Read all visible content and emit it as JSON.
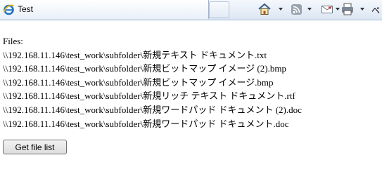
{
  "tab": {
    "title": "Test"
  },
  "toolbar": {
    "trailing_text": "ペ"
  },
  "page": {
    "files_label": "Files:",
    "files": [
      "\\\\192.168.11.146\\test_work\\subfolder\\新規テキスト ドキュメント.txt",
      "\\\\192.168.11.146\\test_work\\subfolder\\新規ビットマップ イメージ (2).bmp",
      "\\\\192.168.11.146\\test_work\\subfolder\\新規ビットマップ イメージ.bmp",
      "\\\\192.168.11.146\\test_work\\subfolder\\新規リッチ テキスト ドキュメント.rtf",
      "\\\\192.168.11.146\\test_work\\subfolder\\新規ワードパッド ドキュメント (2).doc",
      "\\\\192.168.11.146\\test_work\\subfolder\\新規ワードパッド ドキュメント.doc"
    ],
    "button_label": "Get file list"
  }
}
